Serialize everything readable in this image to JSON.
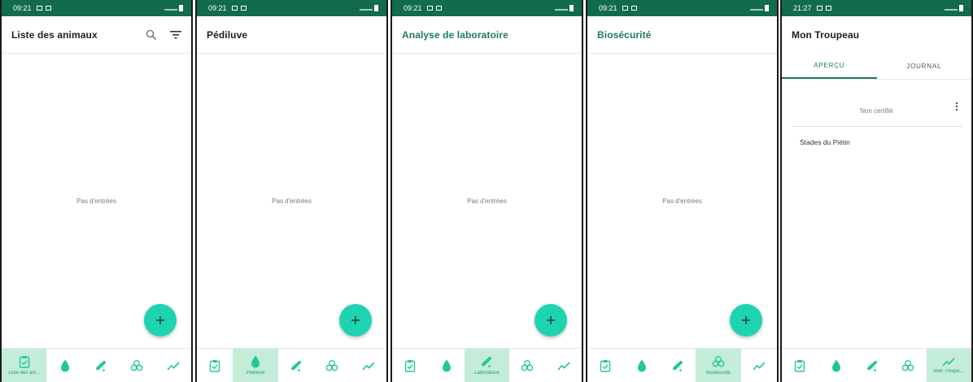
{
  "screens": [
    {
      "status_time": "09:21",
      "title": "Liste des animaux",
      "title_accent": false,
      "empty_text": "Pas d'entrées",
      "fab_label": "+",
      "nav_active": 0,
      "nav_label": "Liste des ani..."
    },
    {
      "status_time": "09:21",
      "title": "Pédiluve",
      "title_accent": false,
      "empty_text": "Pas d'entrées",
      "fab_label": "+",
      "nav_active": 1,
      "nav_label": "Pédiluve"
    },
    {
      "status_time": "09:21",
      "title": "Analyse de laboratoire",
      "title_accent": true,
      "empty_text": "Pas d'entrées",
      "fab_label": "+",
      "nav_active": 2,
      "nav_label": "Laboratoire"
    },
    {
      "status_time": "09:21",
      "title": "Biosécurité",
      "title_accent": true,
      "empty_text": "Pas d'entrées",
      "fab_label": "+",
      "nav_active": 3,
      "nav_label": "Biosécurité"
    },
    {
      "status_time": "21:27",
      "title": "Mon Troupeau",
      "title_accent": false,
      "tabs": [
        "APERÇU",
        "JOURNAL"
      ],
      "active_tab": 0,
      "card_status": "Non certifié",
      "section_label": "Stades du Piétin",
      "nav_active": 4,
      "nav_label": "Mon Troupe..."
    }
  ],
  "nav_icons": [
    "clipboard-check-icon",
    "water-drop-icon",
    "test-tube-icon",
    "biohazard-icon",
    "trend-line-icon"
  ],
  "colors": {
    "status_bar": "#126b4c",
    "accent": "#1ed4b0",
    "nav_active_bg": "#c3ecd9",
    "title_accent": "#1f7a5c"
  }
}
